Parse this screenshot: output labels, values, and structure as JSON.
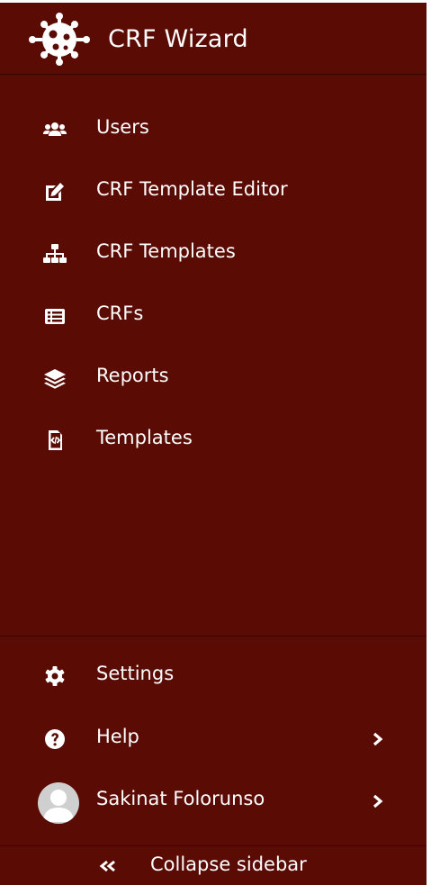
{
  "brand": {
    "title": "CRF Wizard",
    "logo_icon": "virus-icon"
  },
  "nav": {
    "items": [
      {
        "label": "Users",
        "icon": "users-icon"
      },
      {
        "label": "CRF Template Editor",
        "icon": "edit-icon"
      },
      {
        "label": "CRF Templates",
        "icon": "sitemap-icon"
      },
      {
        "label": "CRFs",
        "icon": "list-icon"
      },
      {
        "label": "Reports",
        "icon": "layers-icon"
      },
      {
        "label": "Templates",
        "icon": "file-code-icon"
      }
    ]
  },
  "footer": {
    "settings_label": "Settings",
    "help_label": "Help",
    "user_name": "Sakinat Folorunso",
    "collapse_label": "Collapse sidebar"
  },
  "colors": {
    "sidebar_bg": "#5a0b04",
    "text": "#ffffff"
  }
}
